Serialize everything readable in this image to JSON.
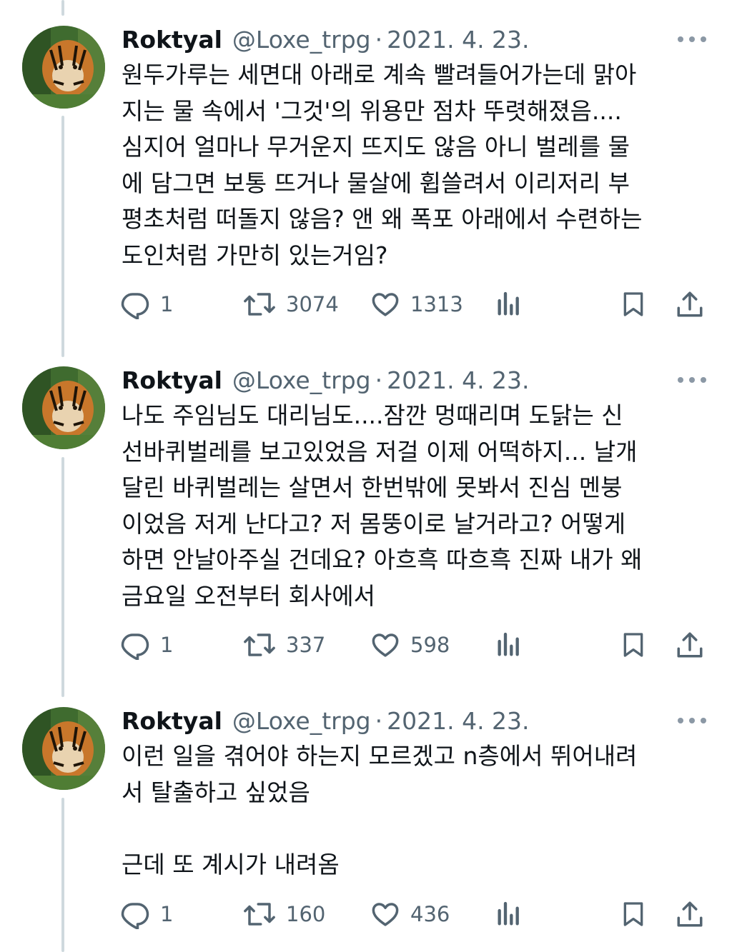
{
  "tweets": [
    {
      "author_name": "Roktyal",
      "handle": "@Loxe_trpg",
      "separator": "·",
      "date": "2021. 4. 23.",
      "text": "원두가루는 세면대 아래로 계속 빨려들어가는데 맑아\n지는 물 속에서 '그것'의 위용만 점차 뚜렷해졌음....\n심지어 얼마나 무거운지 뜨지도 않음 아니 벌레를 물\n에 담그면 보통 뜨거나 물살에 휩쓸려서 이리저리 부\n평초처럼 떠돌지 않음? 앤 왜 폭포 아래에서 수련하는\n도인처럼 가만히 있는거임?",
      "replies": "1",
      "retweets": "3074",
      "likes": "1313"
    },
    {
      "author_name": "Roktyal",
      "handle": "@Loxe_trpg",
      "separator": "·",
      "date": "2021. 4. 23.",
      "text": "나도 주임님도 대리님도....잠깐 멍때리며 도닭는 신\n선바퀴벌레를 보고있었음 저걸 이제 어떡하지... 날개\n달린 바퀴벌레는 살면서 한번밖에 못봐서 진심 멘붕\n이었음 저게 난다고? 저 몸뚱이로 날거라고? 어떻게\n하면 안날아주실 건데요? 아흐흑 따흐흑 진짜 내가 왜\n금요일 오전부터 회사에서",
      "replies": "1",
      "retweets": "337",
      "likes": "598"
    },
    {
      "author_name": "Roktyal",
      "handle": "@Loxe_trpg",
      "separator": "·",
      "date": "2021. 4. 23.",
      "text": "이런 일을 겪어야 하는지 모르겠고 n층에서 뛰어내려\n서 탈출하고 싶었음\n\n근데 또 계시가 내려옴",
      "replies": "1",
      "retweets": "160",
      "likes": "436"
    }
  ],
  "icons": {
    "reply": "reply-icon",
    "retweet": "retweet-icon",
    "like": "heart-icon",
    "views": "views-icon",
    "bookmark": "bookmark-icon",
    "share": "share-icon",
    "more": "more-icon"
  },
  "colors": {
    "text": "#0f1419",
    "secondary": "#536471",
    "thread_line": "#cfd9de"
  }
}
